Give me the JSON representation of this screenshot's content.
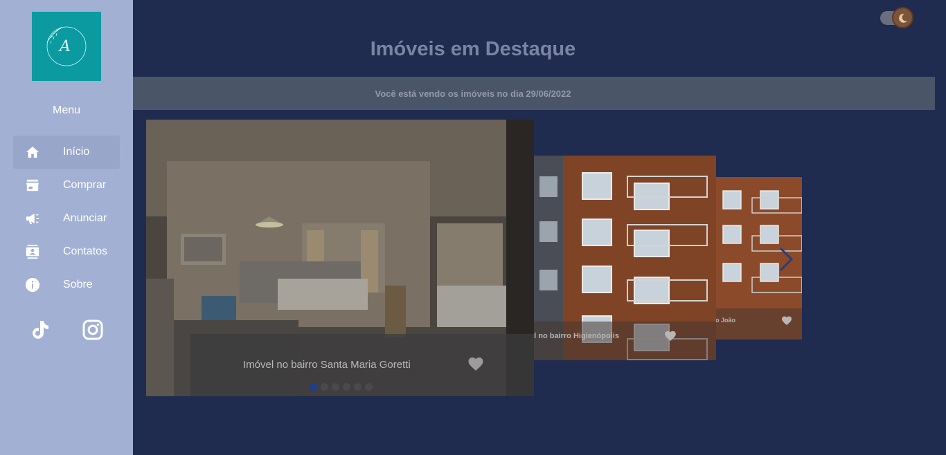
{
  "sidebar": {
    "logo_letter": "A",
    "menu_title": "Menu",
    "items": [
      {
        "label": "Início",
        "icon": "home-icon",
        "active": true
      },
      {
        "label": "Comprar",
        "icon": "store-icon",
        "active": false
      },
      {
        "label": "Anunciar",
        "icon": "megaphone-icon",
        "active": false
      },
      {
        "label": "Contatos",
        "icon": "contacts-icon",
        "active": false
      },
      {
        "label": "Sobre",
        "icon": "info-icon",
        "active": false
      }
    ],
    "social": [
      "tiktok-icon",
      "instagram-icon"
    ]
  },
  "main": {
    "title": "Imóveis em Destaque",
    "date_text": "Você está vendo os imóveis no dia 29/06/2022",
    "theme_toggle": {
      "state": "dark"
    }
  },
  "carousel": {
    "slides": [
      {
        "caption": "Imóvel no bairro Santa Maria Goretti"
      },
      {
        "caption": "el no bairro Higienópolis"
      },
      {
        "caption": "São João"
      }
    ],
    "dots_count": 6,
    "active_dot": 0
  },
  "colors": {
    "sidebar_bg": "#a1b0d3",
    "logo_bg": "#0a9aa0",
    "main_bg": "#1f2b4f",
    "date_bar_bg": "#4a5568",
    "active_dot": "#1d3f8a"
  }
}
